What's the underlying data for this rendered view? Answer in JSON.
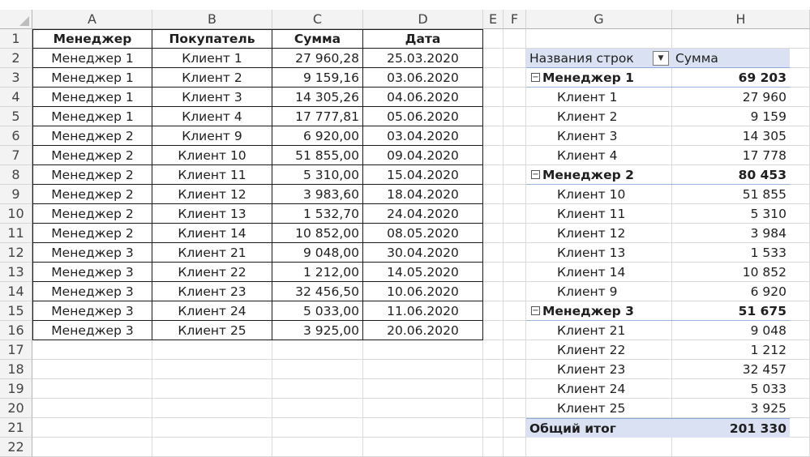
{
  "columns": [
    "A",
    "B",
    "C",
    "D",
    "E",
    "F",
    "G",
    "H"
  ],
  "rows": [
    "1",
    "2",
    "3",
    "4",
    "5",
    "6",
    "7",
    "8",
    "9",
    "10",
    "11",
    "12",
    "13",
    "14",
    "15",
    "16",
    "17",
    "18",
    "19",
    "20",
    "21",
    "22"
  ],
  "table": {
    "headers": [
      "Менеджер",
      "Покупатель",
      "Сумма",
      "Дата"
    ],
    "rows": [
      [
        "Менеджер 1",
        "Клиент 1",
        "27 960,28",
        "25.03.2020"
      ],
      [
        "Менеджер 1",
        "Клиент 2",
        "9 159,16",
        "03.06.2020"
      ],
      [
        "Менеджер 1",
        "Клиент 3",
        "14 305,26",
        "04.06.2020"
      ],
      [
        "Менеджер 1",
        "Клиент 4",
        "17 777,81",
        "05.06.2020"
      ],
      [
        "Менеджер 2",
        "Клиент 9",
        "6 920,00",
        "03.04.2020"
      ],
      [
        "Менеджер 2",
        "Клиент 10",
        "51 855,00",
        "09.04.2020"
      ],
      [
        "Менеджер 2",
        "Клиент 11",
        "5 310,00",
        "15.04.2020"
      ],
      [
        "Менеджер 2",
        "Клиент 12",
        "3 983,60",
        "18.04.2020"
      ],
      [
        "Менеджер 2",
        "Клиент 13",
        "1 532,70",
        "24.04.2020"
      ],
      [
        "Менеджер 2",
        "Клиент 14",
        "10 852,00",
        "08.05.2020"
      ],
      [
        "Менеджер 3",
        "Клиент 21",
        "9 048,00",
        "30.04.2020"
      ],
      [
        "Менеджер 3",
        "Клиент 22",
        "1 212,00",
        "14.05.2020"
      ],
      [
        "Менеджер 3",
        "Клиент 23",
        "32 456,50",
        "10.06.2020"
      ],
      [
        "Менеджер 3",
        "Клиент 24",
        "5 033,00",
        "11.06.2020"
      ],
      [
        "Менеджер 3",
        "Клиент 25",
        "3 925,00",
        "20.06.2020"
      ]
    ]
  },
  "pivot": {
    "header_label": "Названия строк",
    "header_value": "Сумма",
    "groups": [
      {
        "name": "Менеджер 1",
        "total": "69 203",
        "items": [
          {
            "name": "Клиент 1",
            "value": "27 960"
          },
          {
            "name": "Клиент 2",
            "value": "9 159"
          },
          {
            "name": "Клиент 3",
            "value": "14 305"
          },
          {
            "name": "Клиент 4",
            "value": "17 778"
          }
        ]
      },
      {
        "name": "Менеджер 2",
        "total": "80 453",
        "items": [
          {
            "name": "Клиент 10",
            "value": "51 855"
          },
          {
            "name": "Клиент 11",
            "value": "5 310"
          },
          {
            "name": "Клиент 12",
            "value": "3 984"
          },
          {
            "name": "Клиент 13",
            "value": "1 533"
          },
          {
            "name": "Клиент 14",
            "value": "10 852"
          },
          {
            "name": "Клиент 9",
            "value": "6 920"
          }
        ]
      },
      {
        "name": "Менеджер 3",
        "total": "51 675",
        "items": [
          {
            "name": "Клиент 21",
            "value": "9 048"
          },
          {
            "name": "Клиент 22",
            "value": "1 212"
          },
          {
            "name": "Клиент 23",
            "value": "32 457"
          },
          {
            "name": "Клиент 24",
            "value": "5 033"
          },
          {
            "name": "Клиент 25",
            "value": "3 925"
          }
        ]
      }
    ],
    "grand_label": "Общий итог",
    "grand_total": "201 330",
    "collapse_symbol": "−",
    "dropdown_symbol": "▼"
  }
}
